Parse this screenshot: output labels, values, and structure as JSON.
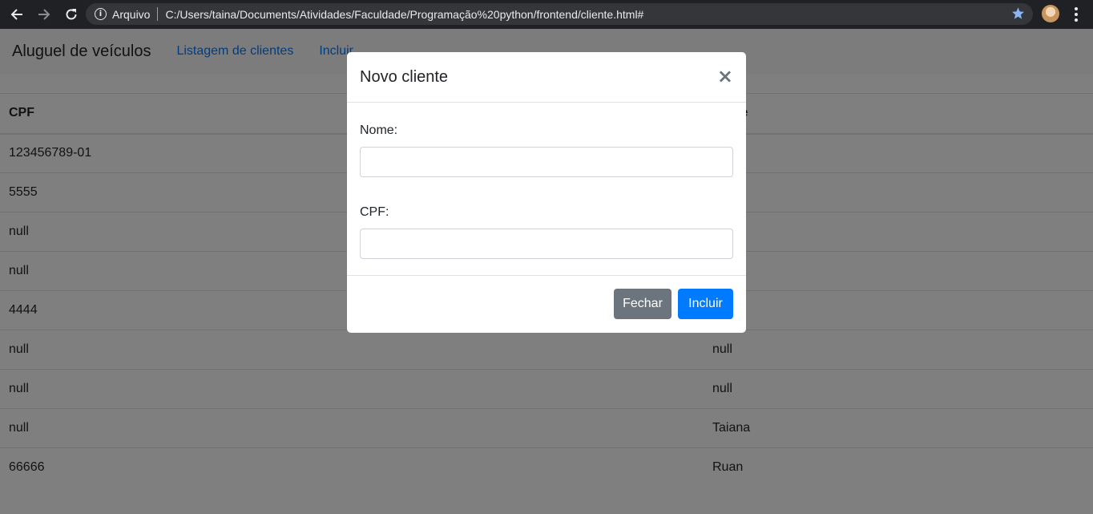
{
  "browser": {
    "scheme_label": "Arquivo",
    "url": "C:/Users/taina/Documents/Atividades/Faculdade/Programação%20python/frontend/cliente.html#"
  },
  "navbar": {
    "brand": "Aluguel de veículos",
    "links": [
      "Listagem de clientes",
      "Incluir"
    ]
  },
  "table": {
    "headers": [
      "CPF",
      "Nome"
    ],
    "rows": [
      [
        "123456789-01",
        ""
      ],
      [
        "5555",
        ""
      ],
      [
        "null",
        ""
      ],
      [
        "null",
        ""
      ],
      [
        "4444",
        ""
      ],
      [
        "null",
        "null"
      ],
      [
        "null",
        "null"
      ],
      [
        "null",
        "Taiana"
      ],
      [
        "66666",
        "Ruan"
      ]
    ]
  },
  "modal": {
    "title": "Novo cliente",
    "close_glyph": "×",
    "fields": [
      {
        "label": "Nome:",
        "value": ""
      },
      {
        "label": "CPF:",
        "value": ""
      }
    ],
    "buttons": {
      "close": "Fechar",
      "submit": "Incluir"
    }
  },
  "colors": {
    "primary": "#007bff",
    "secondary": "#6c757d",
    "chrome": "#202124"
  }
}
